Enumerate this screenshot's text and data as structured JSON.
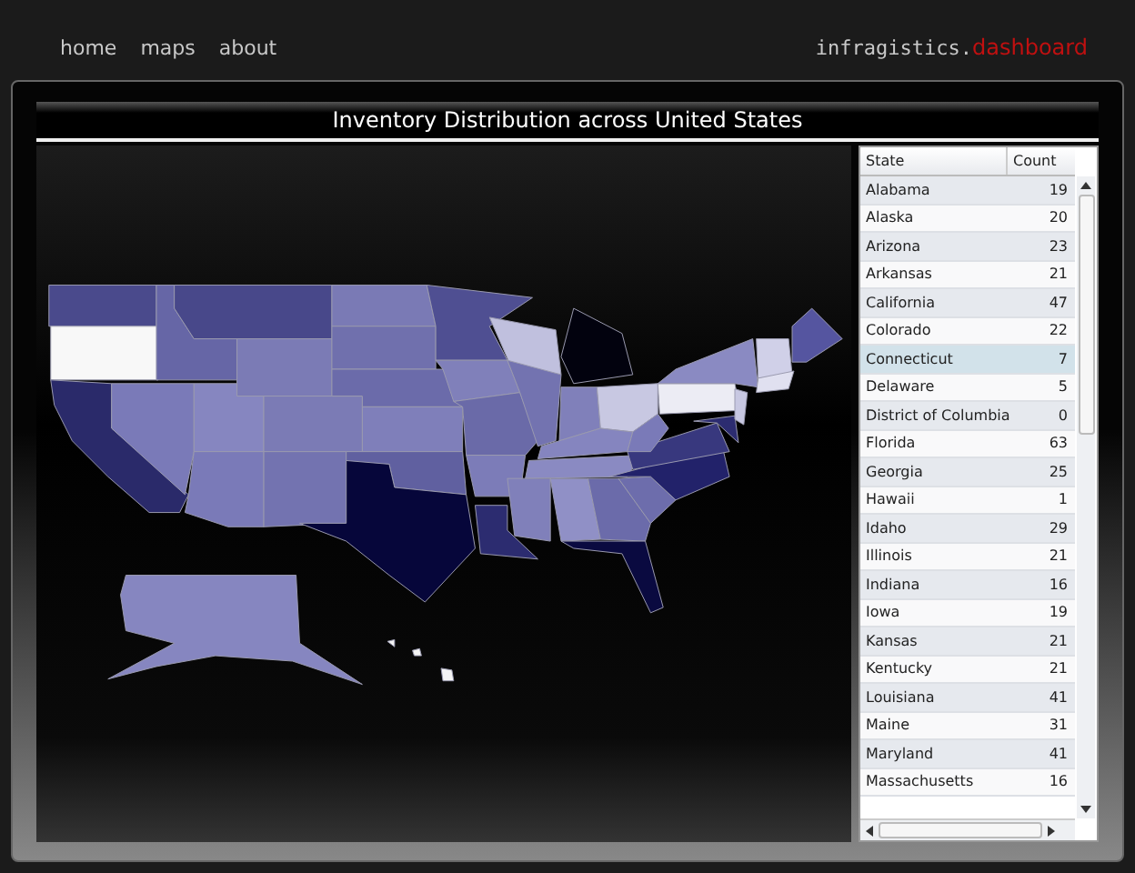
{
  "nav": [
    {
      "label": "home"
    },
    {
      "label": "maps"
    },
    {
      "label": "about"
    }
  ],
  "brand": {
    "name": "infragistics.",
    "accent": "dashboard"
  },
  "panel": {
    "title": "Inventory Distribution across United States"
  },
  "table": {
    "columns": [
      "State",
      "Count"
    ],
    "rows": [
      {
        "state": "Alabama",
        "count": "19",
        "selected": false
      },
      {
        "state": "Alaska",
        "count": "20",
        "selected": false
      },
      {
        "state": "Arizona",
        "count": "23",
        "selected": false
      },
      {
        "state": "Arkansas",
        "count": "21",
        "selected": false
      },
      {
        "state": "California",
        "count": "47",
        "selected": false
      },
      {
        "state": "Colorado",
        "count": "22",
        "selected": false
      },
      {
        "state": "Connecticut",
        "count": "7",
        "selected": true
      },
      {
        "state": "Delaware",
        "count": "5",
        "selected": false
      },
      {
        "state": "District of Columbia",
        "count": "0",
        "selected": false
      },
      {
        "state": "Florida",
        "count": "63",
        "selected": false
      },
      {
        "state": "Georgia",
        "count": "25",
        "selected": false
      },
      {
        "state": "Hawaii",
        "count": "1",
        "selected": false
      },
      {
        "state": "Idaho",
        "count": "29",
        "selected": false
      },
      {
        "state": "Illinois",
        "count": "21",
        "selected": false
      },
      {
        "state": "Indiana",
        "count": "16",
        "selected": false
      },
      {
        "state": "Iowa",
        "count": "19",
        "selected": false
      },
      {
        "state": "Kansas",
        "count": "21",
        "selected": false
      },
      {
        "state": "Kentucky",
        "count": "21",
        "selected": false
      },
      {
        "state": "Louisiana",
        "count": "41",
        "selected": false
      },
      {
        "state": "Maine",
        "count": "31",
        "selected": false
      },
      {
        "state": "Maryland",
        "count": "41",
        "selected": false
      },
      {
        "state": "Massachusetts",
        "count": "16",
        "selected": false
      }
    ]
  }
}
